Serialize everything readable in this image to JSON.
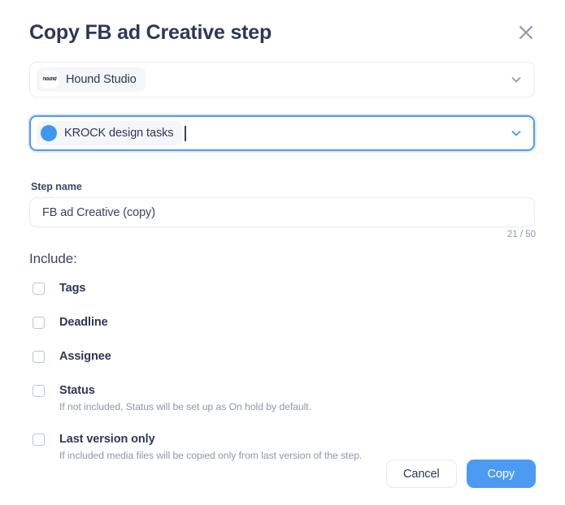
{
  "dialog": {
    "title": "Copy FB ad Creative step",
    "close_icon": "close-icon"
  },
  "workspace_select": {
    "chip_label": "Hound Studio",
    "avatar_wordmark": "hound",
    "chevron_icon": "chevron-down-icon"
  },
  "project_select": {
    "chip_label": "KROCK design tasks",
    "avatar_color": "#3f97f2",
    "chevron_icon": "chevron-down-icon",
    "focused": true
  },
  "step_name": {
    "label": "Step name",
    "value": "FB ad Creative (copy)",
    "placeholder": "Step name",
    "counter": "21 / 50"
  },
  "include": {
    "heading": "Include:",
    "options": [
      {
        "label": "Tags",
        "checked": false,
        "hint": ""
      },
      {
        "label": "Deadline",
        "checked": false,
        "hint": ""
      },
      {
        "label": "Assignee",
        "checked": false,
        "hint": ""
      },
      {
        "label": "Status",
        "checked": false,
        "hint": "If not included, Status will be set up as On hold by default."
      },
      {
        "label": "Last version only",
        "checked": false,
        "hint": "If included media files will be copied only from last version of the step."
      }
    ]
  },
  "footer": {
    "cancel_label": "Cancel",
    "copy_label": "Copy"
  },
  "theme": {
    "accent": "#4c9bf2",
    "title_color": "#2e3757",
    "hint_color": "#8e97ad",
    "border_color": "#e6e9f0"
  }
}
